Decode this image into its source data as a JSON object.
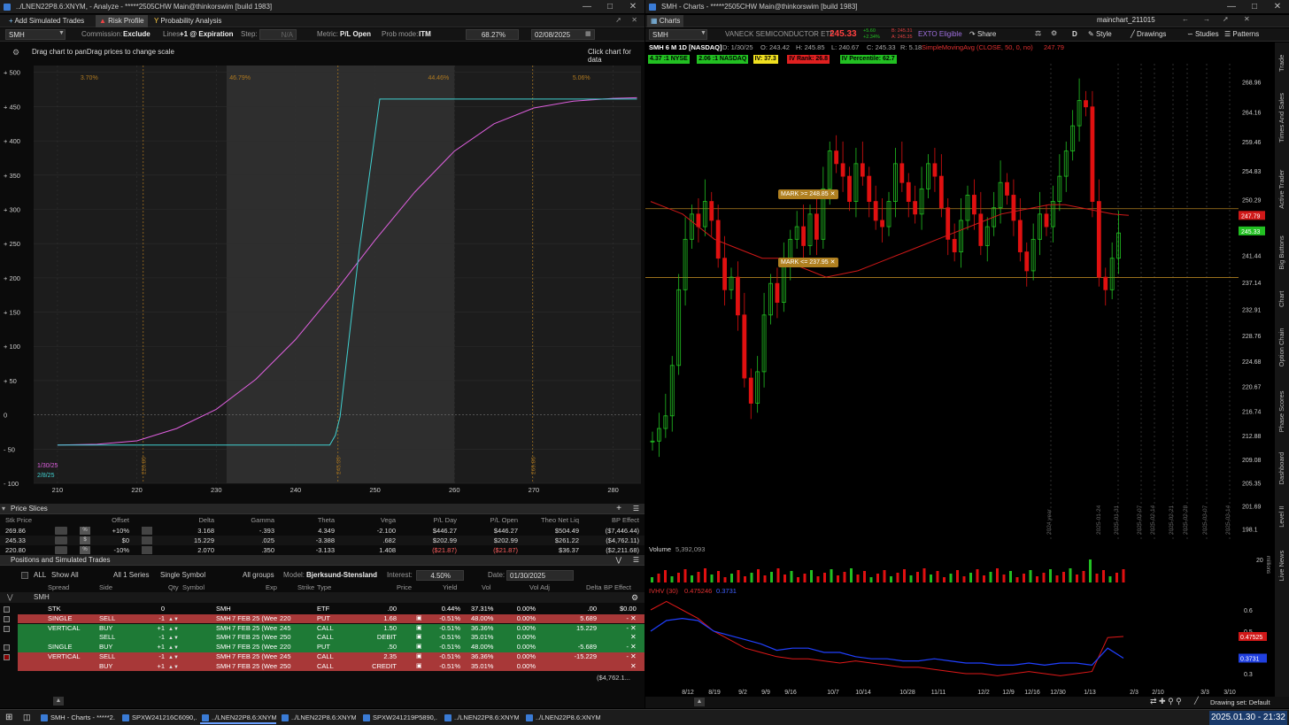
{
  "left_window": {
    "title": "../LNEN22P8.6:XNYM,  - Analyze - *****2505CHW Main@thinkorswim [build 1983]",
    "toolbar": {
      "add_simulated": "Add Simulated Trades",
      "risk_profile": "Risk Profile",
      "probability": "Probability Analysis"
    },
    "settings": {
      "symbol": "SMH",
      "commission_label": "Commission:",
      "commission": "Exclude",
      "lines_label": "Lines:",
      "lines": "+1 @ Expiration",
      "step_label": "Step:",
      "step": "N/A",
      "metric_label": "Metric:",
      "metric": "P/L Open",
      "prob_mode_label": "Prob mode:",
      "prob_mode": "ITM",
      "prob_value": "68.27%",
      "date": "02/08/2025"
    },
    "chart_hint": "Drag chart to panDrag prices to change scale",
    "chart_hint_right": "Click chart for data",
    "risk_chart": {
      "type": "line",
      "y_ticks": [
        "+ 500",
        "+ 450",
        "+ 400",
        "+ 350",
        "+ 300",
        "+ 250",
        "+ 200",
        "+ 150",
        "+ 100",
        "+ 50",
        "0",
        "- 50",
        "- 100"
      ],
      "x_ticks": [
        "210",
        "220",
        "230",
        "240",
        "250",
        "260",
        "270",
        "280"
      ],
      "zone_pcts": [
        "3.70%",
        "46.79%",
        "44.46%",
        "5.06%"
      ],
      "vlines": [
        "220.80",
        "245.33",
        "269.86"
      ],
      "legend": [
        {
          "label": "1/30/25",
          "color": "#e060e0"
        },
        {
          "label": "2/8/25",
          "color": "#40d0d0"
        }
      ],
      "series": [
        {
          "name": "1/30/25",
          "color": "#e060e0",
          "x": [
            210,
            215,
            220,
            225,
            230,
            235,
            240,
            245,
            250,
            255,
            260,
            265,
            270,
            275,
            280,
            283
          ],
          "y": [
            -44,
            -43,
            -38,
            -20,
            8,
            52,
            110,
            180,
            255,
            325,
            385,
            425,
            448,
            458,
            462,
            463
          ]
        },
        {
          "name": "2/8/25",
          "color": "#40d0d0",
          "x": [
            210,
            220,
            244.3,
            245,
            245.6,
            248,
            250.6,
            255,
            260,
            270,
            283
          ],
          "y": [
            -44,
            -44,
            -44,
            -30,
            -3,
            240,
            461,
            461,
            461,
            461,
            461
          ]
        }
      ],
      "xlim": [
        207,
        283.5
      ],
      "ylim": [
        -100,
        510
      ]
    },
    "price_slices": {
      "title": "Price Slices",
      "headers": [
        "Stk Price",
        "Offset",
        "Delta",
        "Gamma",
        "Theta",
        "Vega",
        "P/L Day",
        "P/L Open",
        "Theo Net Liq",
        "BP Effect"
      ],
      "rows": [
        [
          "269.86",
          "+10%",
          "3.168",
          "-.393",
          "4.349",
          "-2.100",
          "$446.27",
          "$446.27",
          "$504.49",
          "($7,446.44)"
        ],
        [
          "245.33",
          "$0",
          "15.229",
          ".025",
          "-3.388",
          ".682",
          "$202.99",
          "$202.99",
          "$261.22",
          "($4,762.11)"
        ],
        [
          "220.80",
          "-10%",
          "2.070",
          ".350",
          "-3.133",
          "1.408",
          "($21.87)",
          "($21.87)",
          "$36.37",
          "($2,211.68)"
        ]
      ]
    },
    "positions": {
      "title": "Positions and Simulated Trades",
      "filters": {
        "all": "ALL",
        "show_all": "Show All",
        "series": "All 1 Series",
        "single_symbol": "Single Symbol",
        "all_groups": "All groups",
        "model_label": "Model:",
        "model": "Bjerksund-Stensland",
        "interest_label": "Interest:",
        "interest": "4.50%",
        "date_label": "Date:",
        "date": "01/30/2025"
      },
      "group": "SMH",
      "headers": [
        "Spread",
        "Side",
        "Qty",
        "Symbol",
        "Exp",
        "Strike",
        "Type",
        "Price",
        "Yield",
        "Vol",
        "Vol Adj",
        "Delta",
        "BP Effect"
      ],
      "rows": [
        {
          "spread": "STK",
          "side": "",
          "qty": "0",
          "symbol": "SMH",
          "exp": "",
          "strike": "",
          "type": "ETF",
          "price": ".00",
          "yield": "0.44%",
          "vol": "37.31%",
          "voladj": "0.00%",
          "delta": ".00",
          "bp": "$0.00",
          "bg": "#0b0b0b"
        },
        {
          "spread": "SINGLE",
          "side": "SELL",
          "qty": "-1",
          "symbol": "SMH",
          "exp": "7 FEB 25 (Wee",
          "strike": "220",
          "type": "PUT",
          "price": "1.68",
          "yield": "-0.51%",
          "vol": "48.00%",
          "voladj": "0.00%",
          "delta": "5.689",
          "bp": "-",
          "bg": "#a83838"
        },
        {
          "spread": "VERTICAL",
          "side": "BUY",
          "qty": "+1",
          "symbol": "SMH",
          "exp": "7 FEB 25 (Wee",
          "strike": "245",
          "type": "CALL",
          "price": "1.50",
          "yield": "-0.51%",
          "vol": "36.36%",
          "voladj": "0.00%",
          "delta": "15.229",
          "bp": "-",
          "bg": "#1e7a36"
        },
        {
          "spread": "",
          "side": "SELL",
          "qty": "-1",
          "symbol": "SMH",
          "exp": "7 FEB 25 (Wee",
          "strike": "250",
          "type": "CALL",
          "price": "DEBIT",
          "yield": "-0.51%",
          "vol": "35.01%",
          "voladj": "0.00%",
          "delta": "",
          "bp": "",
          "bg": "#1e7a36"
        },
        {
          "spread": "SINGLE",
          "side": "BUY",
          "qty": "+1",
          "symbol": "SMH",
          "exp": "7 FEB 25 (Wee",
          "strike": "220",
          "type": "PUT",
          "price": ".50",
          "yield": "-0.51%",
          "vol": "48.00%",
          "voladj": "0.00%",
          "delta": "-5.689",
          "bp": "-",
          "bg": "#1e7a36"
        },
        {
          "spread": "VERTICAL",
          "side": "SELL",
          "qty": "-1",
          "symbol": "SMH",
          "exp": "7 FEB 25 (Wee",
          "strike": "245",
          "type": "CALL",
          "price": "2.35",
          "yield": "-0.51%",
          "vol": "36.36%",
          "voladj": "0.00%",
          "delta": "-15.229",
          "bp": "-",
          "bg": "#a83838"
        },
        {
          "spread": "",
          "side": "BUY",
          "qty": "+1",
          "symbol": "SMH",
          "exp": "7 FEB 25 (Wee",
          "strike": "250",
          "type": "CALL",
          "price": "CREDIT",
          "yield": "-0.51%",
          "vol": "35.01%",
          "voladj": "0.00%",
          "delta": "",
          "bp": "",
          "bg": "#a83838"
        }
      ],
      "total_bp": "($4,762.1..."
    }
  },
  "right_window": {
    "title": "SMH - Charts - *****2505CHW Main@thinkorswim [build 1983]",
    "tab": "Charts",
    "layout_name": "mainchart_211015",
    "symbol": "SMH",
    "description": "VANECK SEMICONDUCTOR ETF",
    "last": "245.33",
    "change_top": "+5.60",
    "change_pct": "+2.34%",
    "bid": "B: 245.31",
    "ask": "A: 245.35",
    "etf_label": "EXTO Eligible",
    "buttons": {
      "share": "Share",
      "style": "Style",
      "drawings": "Drawings",
      "studies": "Studies",
      "patterns": "Patterns",
      "period": "D"
    },
    "header_line": "SMH 6 M 1D [NASDAQ]",
    "ohlc": {
      "d": "D: 1/30/25",
      "o": "O: 243.42",
      "h": "H: 245.85",
      "l": "L: 240.67",
      "c": "C: 245.33",
      "r": "R: 5.18"
    },
    "sma_label": "SimpleMovingAvg (CLOSE, 50, 0, no)",
    "sma_value": "247.79",
    "chips": [
      {
        "text": "4.37 :1 NYSE",
        "bg": "#22c022",
        "fg": "#000"
      },
      {
        "text": "2.06 :1 NASDAQ",
        "bg": "#22c022",
        "fg": "#000"
      },
      {
        "text": "IV: 37.3",
        "bg": "#f0e020",
        "fg": "#000"
      },
      {
        "text": "IV Rank: 26.8",
        "bg": "#e02020",
        "fg": "#000"
      },
      {
        "text": "IV Percentile: 62.7",
        "bg": "#22c022",
        "fg": "#000"
      }
    ],
    "mark_upper": "MARK >= 248.85",
    "mark_lower": "MARK <= 237.95",
    "price_axis": [
      "268.96",
      "264.16",
      "259.46",
      "254.83",
      "250.29",
      "241.44",
      "237.14",
      "232.91",
      "228.76",
      "224.68",
      "220.67",
      "216.74",
      "212.88",
      "209.08",
      "205.35",
      "201.69",
      "198.1"
    ],
    "price_badge_sma": "247.79",
    "price_badge_last": "245.33",
    "date_labels": [
      "2024 year",
      "2025-01-24",
      "2025-01-31",
      "2025-02-07",
      "2025-02-14",
      "2025-02-21",
      "2025-02-28",
      "2025-03-07",
      "2025-03-14"
    ],
    "volume_label": "Volume",
    "volume_value": "5,392,093",
    "volume_axis": "20",
    "volume_unit": "millions",
    "ivhv_label": "IVHV (30)",
    "ivhv_v1": "0.475246",
    "ivhv_v2": "0.3731",
    "ivhv_axis": [
      "0.6",
      "0.5",
      "0.3"
    ],
    "ivhv_badge1": "0.47525",
    "ivhv_badge2": "0.3731",
    "x_axis": [
      "8/12",
      "8/19",
      "9/2",
      "9/9",
      "9/16",
      "10/7",
      "10/14",
      "10/28",
      "11/11",
      "12/2",
      "12/9",
      "12/16",
      "12/30",
      "1/13",
      "2/3",
      "2/10",
      "3/3",
      "3/10"
    ],
    "side_tabs": [
      "Trade",
      "Times And Sales",
      "Active Trader",
      "Big Buttons",
      "Chart",
      "Option Chain",
      "Phase Scores",
      "Dashboard",
      "Level II",
      "Live News"
    ],
    "drawing_set": "Drawing set: Default"
  },
  "taskbar": {
    "items": [
      "SMH - Charts - *****2...",
      "SPXW241216C6090,...",
      "../LNEN22P8.6:XNYM...",
      "../LNEN22P8.6:XNYM...",
      "SPXW241219P5890,...",
      "../LNEN22P8.6:XNYM...",
      "../LNEN22P8.6:XNYM..."
    ],
    "clock": "2025.01.30 - 21:32"
  },
  "colors": {
    "up": "#22c022",
    "down": "#e01010",
    "sma": "#d01818",
    "mark": "#b08020"
  }
}
